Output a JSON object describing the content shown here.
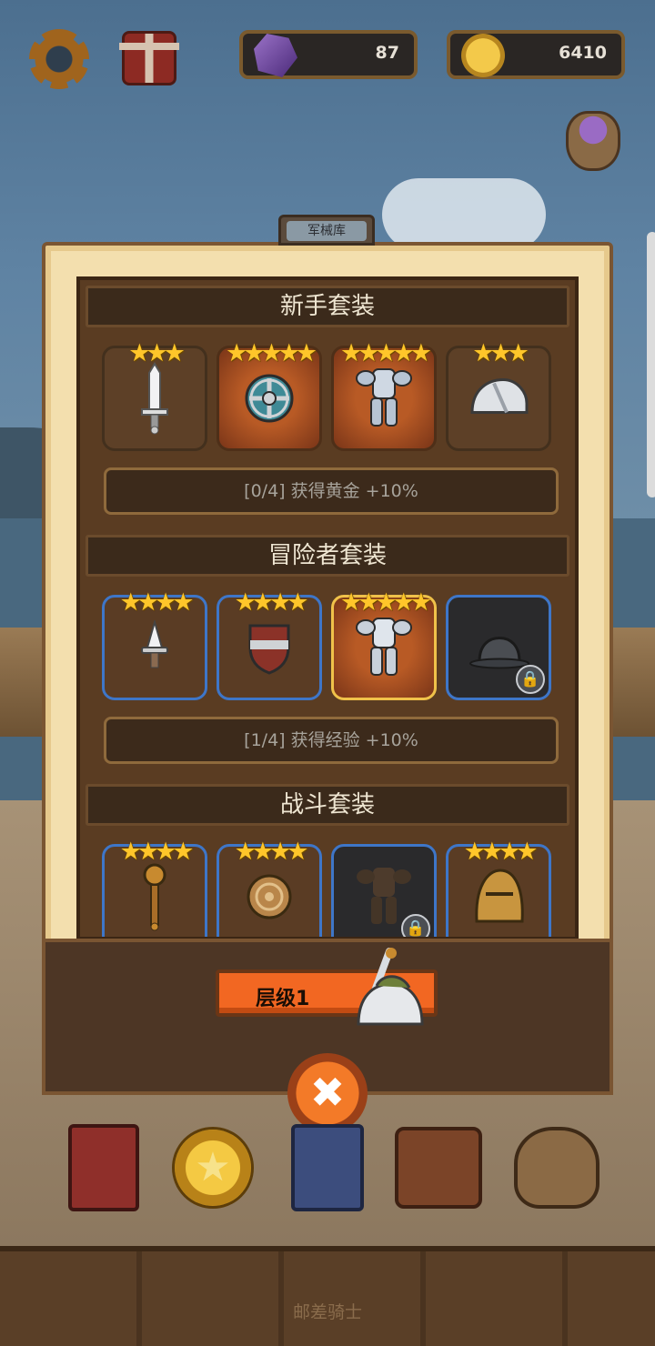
{
  "hud": {
    "gems": "87",
    "gold": "6410"
  },
  "panel": {
    "tab_label": "军械库"
  },
  "sets": [
    {
      "name": "新手套装",
      "bonus": "[0/4] 获得黄金 +10%",
      "items": [
        {
          "stars": "★★★",
          "icon": "sword-icon"
        },
        {
          "stars": "★★★★★",
          "icon": "round-shield-icon"
        },
        {
          "stars": "★★★★★",
          "icon": "armor-icon"
        },
        {
          "stars": "★★★",
          "icon": "helmet-icon"
        }
      ]
    },
    {
      "name": "冒险者套装",
      "bonus": "[1/4] 获得经验 +10%",
      "items": [
        {
          "stars": "★★★★",
          "icon": "dagger-icon"
        },
        {
          "stars": "★★★★",
          "icon": "kite-shield-icon"
        },
        {
          "stars": "★★★★★",
          "icon": "armor-icon"
        },
        {
          "stars": "",
          "icon": "helmet-icon",
          "locked": true
        }
      ]
    },
    {
      "name": "战斗套装",
      "items": [
        {
          "stars": "★★★★",
          "icon": "mace-icon"
        },
        {
          "stars": "★★★★",
          "icon": "buckler-icon"
        },
        {
          "stars": "",
          "icon": "armor-icon",
          "locked": true
        },
        {
          "stars": "★★★★",
          "icon": "helmet-icon"
        }
      ]
    }
  ],
  "level_button": "层级1",
  "close_glyph": "✖",
  "nav": {
    "coin_glyph": "★"
  },
  "floor_label": "邮差骑士",
  "colors": {
    "accent_orange": "#f26722",
    "star_gold": "#ffc62a",
    "card_blue_border": "#3e76c8"
  }
}
